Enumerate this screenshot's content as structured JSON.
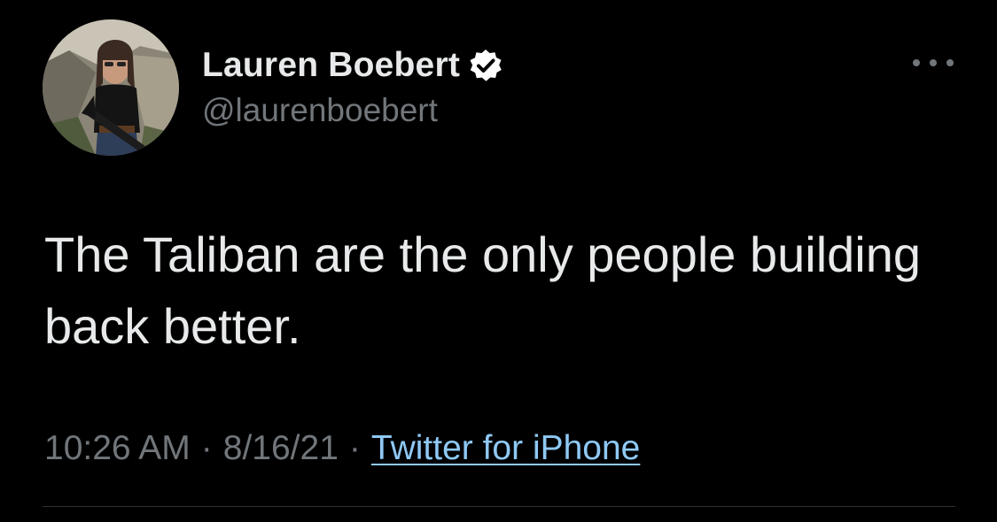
{
  "author": {
    "display_name": "Lauren Boebert",
    "handle": "@laurenboebert",
    "verified_icon": "verified-badge-icon"
  },
  "tweet": {
    "text": "The Taliban are the only people building back better.",
    "time": "10:26 AM",
    "separator": "·",
    "date": "8/16/21",
    "source": "Twitter for iPhone"
  },
  "colors": {
    "background": "#000000",
    "primary_text": "#e7e9ea",
    "secondary_text": "#71767b",
    "link": "#8fc9f5"
  }
}
